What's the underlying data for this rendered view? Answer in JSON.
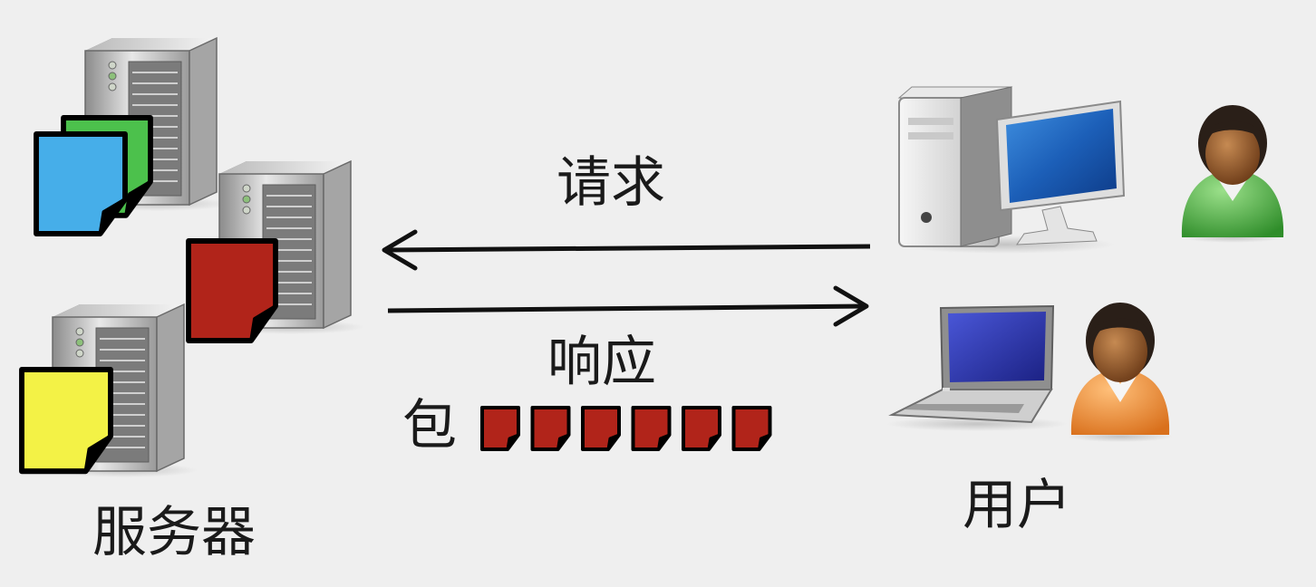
{
  "labels": {
    "servers": "服务器",
    "users": "用户",
    "request": "请求",
    "response": "响应",
    "packets": "包"
  },
  "server_file_colors": [
    "#f3f246",
    "#b1241a",
    "#46aee9",
    "#4cc14c"
  ],
  "packet_color": "#b1241a",
  "packet_count": 6,
  "icons": {
    "server": "server-tower-icon",
    "desktop": "desktop-computer-icon",
    "laptop": "laptop-icon",
    "user": "user-avatar-icon",
    "document": "document-icon",
    "packet": "packet-icon"
  }
}
